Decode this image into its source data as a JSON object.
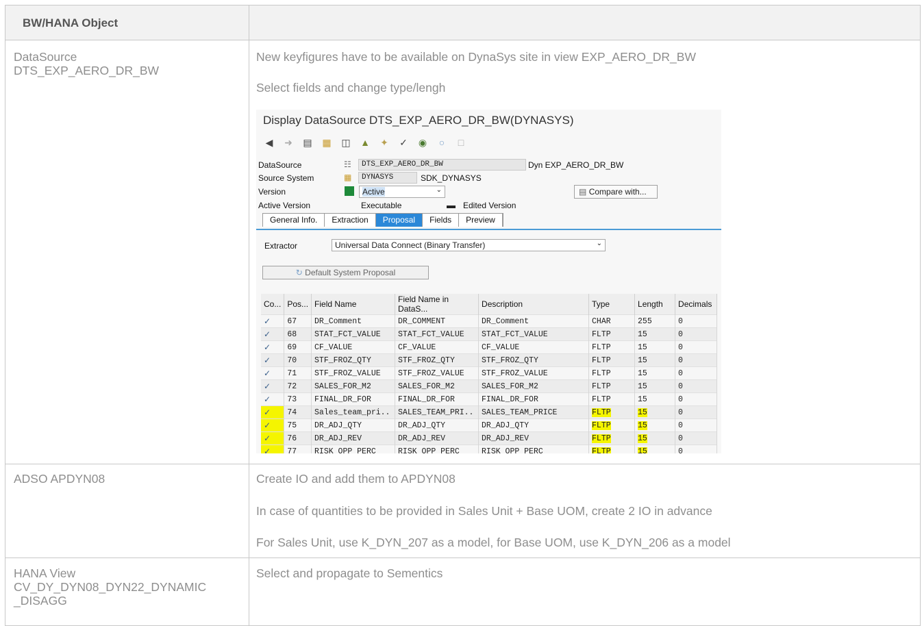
{
  "table": {
    "header": {
      "col1": "BW/HANA Object",
      "col2": ""
    },
    "rows": [
      {
        "object_line1": "DataSource",
        "object_line2": "DTS_EXP_AERO_DR_BW",
        "texts": [
          "New keyfigures have to be available on DynaSys site in view EXP_AERO_DR_BW",
          "Select fields and change type/lengh"
        ]
      },
      {
        "object_line1": "ADSO APDYN08",
        "texts": [
          "Create IO and add them to APDYN08",
          "In case of quantities to be provided in Sales Unit + Base UOM, create 2 IO in advance",
          "For Sales Unit, use K_DYN_207 as a model, for Base UOM, use K_DYN_206 as a model"
        ]
      },
      {
        "object_line1": "HANA View",
        "object_line2": "CV_DY_DYN08_DYN22_DYNAMIC",
        "object_line3": "_DISAGG",
        "texts": [
          "Select and propagate to Sementics"
        ]
      }
    ]
  },
  "sap": {
    "title": "Display DataSource DTS_EXP_AERO_DR_BW(DYNASYS)",
    "toolbar_icons": [
      "back-arrow-icon",
      "forward-arrow-icon",
      "object-list-icon",
      "hierarchy-icon",
      "glasses-icon",
      "transport-icon",
      "wand-icon",
      "check-icon",
      "database-icon",
      "where-used-icon",
      "document-icon"
    ],
    "datasource_label": "DataSource",
    "datasource_value": "DTS_EXP_AERO_DR_BW",
    "datasource_desc": "Dyn EXP_AERO_DR_BW",
    "source_system_label": "Source System",
    "source_system_value": "DYNASYS",
    "source_system_desc": "SDK_DYNASYS",
    "version_label": "Version",
    "version_value": "Active",
    "compare_button": "Compare with...",
    "active_version_label": "Active Version",
    "active_version_value": "Executable",
    "edited_version_label": "Edited Version",
    "tabs": [
      "General Info.",
      "Extraction",
      "Proposal",
      "Fields",
      "Preview"
    ],
    "active_tab": "Proposal",
    "extractor_label": "Extractor",
    "extractor_value": "Universal Data Connect (Binary Transfer)",
    "default_proposal_button": "Default System Proposal",
    "grid_headers": [
      "Co...",
      "Pos...",
      "Field Name",
      "Field Name in DataS...",
      "Description",
      "Type",
      "Length",
      "Decimals"
    ],
    "grid_rows": [
      {
        "pos": "67",
        "field": "DR_Comment",
        "field_ds": "DR_COMMENT",
        "desc": "DR_Comment",
        "type": "CHAR",
        "length": "255",
        "dec": "0",
        "hl": false
      },
      {
        "pos": "68",
        "field": "STAT_FCT_VALUE",
        "field_ds": "STAT_FCT_VALUE",
        "desc": "STAT_FCT_VALUE",
        "type": "FLTP",
        "length": "15",
        "dec": "0",
        "hl": false
      },
      {
        "pos": "69",
        "field": "CF_VALUE",
        "field_ds": "CF_VALUE",
        "desc": "CF_VALUE",
        "type": "FLTP",
        "length": "15",
        "dec": "0",
        "hl": false
      },
      {
        "pos": "70",
        "field": "STF_FROZ_QTY",
        "field_ds": "STF_FROZ_QTY",
        "desc": "STF_FROZ_QTY",
        "type": "FLTP",
        "length": "15",
        "dec": "0",
        "hl": false
      },
      {
        "pos": "71",
        "field": "STF_FROZ_VALUE",
        "field_ds": "STF_FROZ_VALUE",
        "desc": "STF_FROZ_VALUE",
        "type": "FLTP",
        "length": "15",
        "dec": "0",
        "hl": false
      },
      {
        "pos": "72",
        "field": "SALES_FOR_M2",
        "field_ds": "SALES_FOR_M2",
        "desc": "SALES_FOR_M2",
        "type": "FLTP",
        "length": "15",
        "dec": "0",
        "hl": false
      },
      {
        "pos": "73",
        "field": "FINAL_DR_FOR",
        "field_ds": "FINAL_DR_FOR",
        "desc": "FINAL_DR_FOR",
        "type": "FLTP",
        "length": "15",
        "dec": "0",
        "hl": false
      },
      {
        "pos": "74",
        "field": "Sales_team_pri..",
        "field_ds": "SALES_TEAM_PRI..",
        "desc": "SALES_TEAM_PRICE",
        "type": "FLTP",
        "length": "15",
        "dec": "0",
        "hl": true
      },
      {
        "pos": "75",
        "field": "DR_ADJ_QTY",
        "field_ds": "DR_ADJ_QTY",
        "desc": "DR_ADJ_QTY",
        "type": "FLTP",
        "length": "15",
        "dec": "0",
        "hl": true
      },
      {
        "pos": "76",
        "field": "DR_ADJ_REV",
        "field_ds": "DR_ADJ_REV",
        "desc": "DR_ADJ_REV",
        "type": "FLTP",
        "length": "15",
        "dec": "0",
        "hl": true
      },
      {
        "pos": "77",
        "field": "RISK_OPP_PERC",
        "field_ds": "RISK_OPP_PERC",
        "desc": "RISK_OPP_PERC",
        "type": "FLTP",
        "length": "15",
        "dec": "0",
        "hl": true
      }
    ],
    "highlight_color": "#f5f500",
    "active_tab_color": "#2b88d8"
  }
}
